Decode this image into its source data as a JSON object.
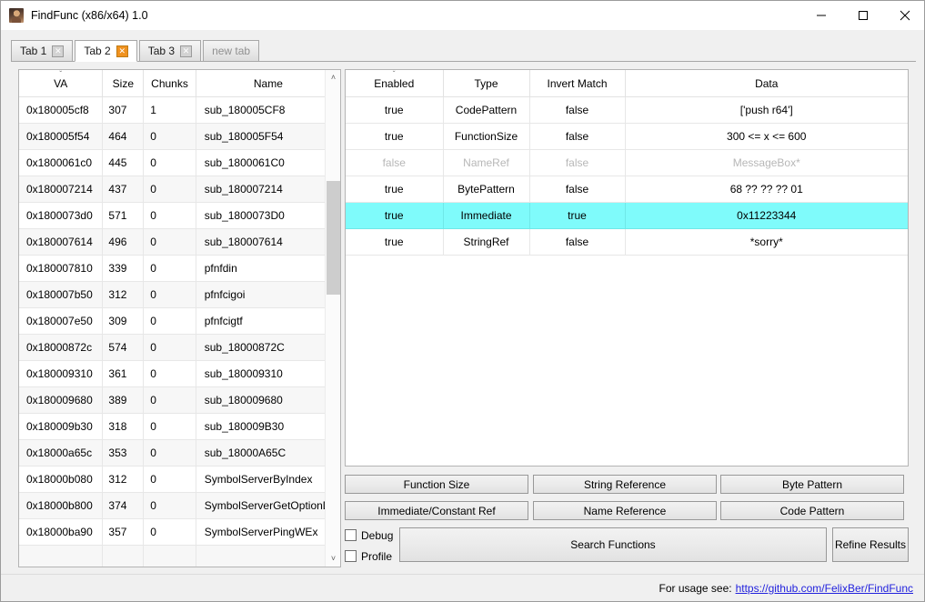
{
  "window": {
    "title": "FindFunc (x86/x64) 1.0",
    "icon": "app-photo-icon",
    "controls": {
      "minimize": "minimize-icon",
      "maximize": "maximize-icon",
      "close": "close-icon"
    }
  },
  "tabs": [
    {
      "label": "Tab 1",
      "close": "✕",
      "selected": false,
      "closable": true
    },
    {
      "label": "Tab 2",
      "close": "✕",
      "selected": true,
      "closable": true
    },
    {
      "label": "Tab 3",
      "close": "✕",
      "selected": false,
      "closable": true
    },
    {
      "label": "new tab",
      "close": "",
      "selected": false,
      "closable": false
    }
  ],
  "functions_table": {
    "sort_indicator": "ˇ",
    "sort_column": "VA",
    "columns": [
      "VA",
      "Size",
      "Chunks",
      "Name"
    ],
    "rows": [
      {
        "va": "0x180005cf8",
        "size": "307",
        "chunks": "1",
        "name": "sub_180005CF8"
      },
      {
        "va": "0x180005f54",
        "size": "464",
        "chunks": "0",
        "name": "sub_180005F54"
      },
      {
        "va": "0x1800061c0",
        "size": "445",
        "chunks": "0",
        "name": "sub_1800061C0"
      },
      {
        "va": "0x180007214",
        "size": "437",
        "chunks": "0",
        "name": "sub_180007214"
      },
      {
        "va": "0x1800073d0",
        "size": "571",
        "chunks": "0",
        "name": "sub_1800073D0"
      },
      {
        "va": "0x180007614",
        "size": "496",
        "chunks": "0",
        "name": "sub_180007614"
      },
      {
        "va": "0x180007810",
        "size": "339",
        "chunks": "0",
        "name": "pfnfdin"
      },
      {
        "va": "0x180007b50",
        "size": "312",
        "chunks": "0",
        "name": "pfnfcigoi"
      },
      {
        "va": "0x180007e50",
        "size": "309",
        "chunks": "0",
        "name": "pfnfcigtf"
      },
      {
        "va": "0x18000872c",
        "size": "574",
        "chunks": "0",
        "name": "sub_18000872C"
      },
      {
        "va": "0x180009310",
        "size": "361",
        "chunks": "0",
        "name": "sub_180009310"
      },
      {
        "va": "0x180009680",
        "size": "389",
        "chunks": "0",
        "name": "sub_180009680"
      },
      {
        "va": "0x180009b30",
        "size": "318",
        "chunks": "0",
        "name": "sub_180009B30"
      },
      {
        "va": "0x18000a65c",
        "size": "353",
        "chunks": "0",
        "name": "sub_18000A65C"
      },
      {
        "va": "0x18000b080",
        "size": "312",
        "chunks": "0",
        "name": "SymbolServerByIndex"
      },
      {
        "va": "0x18000b800",
        "size": "374",
        "chunks": "0",
        "name": "SymbolServerGetOptionData"
      },
      {
        "va": "0x18000ba90",
        "size": "357",
        "chunks": "0",
        "name": "SymbolServerPingWEx"
      }
    ],
    "scrollbar": {
      "up_arrow": "˄",
      "down_arrow": "˅"
    }
  },
  "rules_table": {
    "sort_indicator": "ˇ",
    "sort_column": "Enabled",
    "columns": [
      "Enabled",
      "Type",
      "Invert Match",
      "Data"
    ],
    "rows": [
      {
        "enabled": "true",
        "type": "CodePattern",
        "invert": "false",
        "data": "['push r64']",
        "state": "normal"
      },
      {
        "enabled": "true",
        "type": "FunctionSize",
        "invert": "false",
        "data": "300 <= x <= 600",
        "state": "normal"
      },
      {
        "enabled": "false",
        "type": "NameRef",
        "invert": "false",
        "data": "MessageBox*",
        "state": "disabled"
      },
      {
        "enabled": "true",
        "type": "BytePattern",
        "invert": "false",
        "data": "68  ?? ?? ?? 01",
        "state": "normal"
      },
      {
        "enabled": "true",
        "type": "Immediate",
        "invert": "true",
        "data": "0x11223344",
        "state": "selected"
      },
      {
        "enabled": "true",
        "type": "StringRef",
        "invert": "false",
        "data": "*sorry*",
        "state": "normal"
      }
    ]
  },
  "rule_buttons": [
    {
      "label": "Function Size"
    },
    {
      "label": "String Reference"
    },
    {
      "label": "Byte Pattern"
    },
    {
      "label": "Immediate/Constant Ref"
    },
    {
      "label": "Name Reference"
    },
    {
      "label": "Code Pattern"
    }
  ],
  "options": {
    "debug": {
      "label": "Debug",
      "checked": false
    },
    "profile": {
      "label": "Profile",
      "checked": false
    }
  },
  "actions": {
    "search": "Search Functions",
    "refine": "Refine Results"
  },
  "footer": {
    "text": "For usage see:",
    "link": "https://github.com/FelixBer/FindFunc",
    "link_color": "#2222dd"
  },
  "colors": {
    "selection": "#7ffbfb",
    "tab_active_close": "#f0921f",
    "window_bg": "#f0f0f0"
  }
}
